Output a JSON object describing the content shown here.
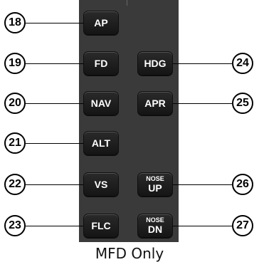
{
  "buttons": {
    "ap": "AP",
    "fd": "FD",
    "hdg": "HDG",
    "nav": "NAV",
    "apr": "APR",
    "alt": "ALT",
    "vs": "VS",
    "nose_up": {
      "top": "NOSE",
      "bottom": "UP"
    },
    "flc": "FLC",
    "nose_dn": {
      "top": "NOSE",
      "bottom": "DN"
    }
  },
  "callouts": {
    "c18": "18",
    "c19": "19",
    "c20": "20",
    "c21": "21",
    "c22": "22",
    "c23": "23",
    "c24": "24",
    "c25": "25",
    "c26": "26",
    "c27": "27"
  },
  "caption": "MFD Only"
}
